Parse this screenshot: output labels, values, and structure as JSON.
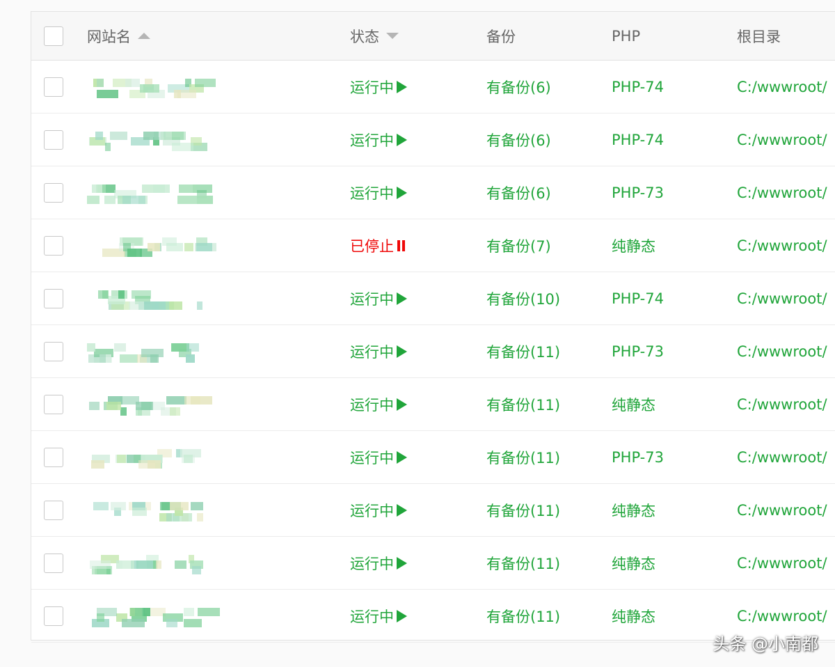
{
  "table": {
    "headers": {
      "name": "网站名",
      "status": "状态",
      "backup": "备份",
      "php": "PHP",
      "root": "根目录"
    },
    "rows": [
      {
        "status": "运行中",
        "state": "running",
        "backup": "有备份(6)",
        "php": "PHP-74",
        "root": "C:/wwwroot/"
      },
      {
        "status": "运行中",
        "state": "running",
        "backup": "有备份(6)",
        "php": "PHP-74",
        "root": "C:/wwwroot/"
      },
      {
        "status": "运行中",
        "state": "running",
        "backup": "有备份(6)",
        "php": "PHP-73",
        "root": "C:/wwwroot/"
      },
      {
        "status": "已停止",
        "state": "stopped",
        "backup": "有备份(7)",
        "php": "纯静态",
        "root": "C:/wwwroot/"
      },
      {
        "status": "运行中",
        "state": "running",
        "backup": "有备份(10)",
        "php": "PHP-74",
        "root": "C:/wwwroot/"
      },
      {
        "status": "运行中",
        "state": "running",
        "backup": "有备份(11)",
        "php": "PHP-73",
        "root": "C:/wwwroot/"
      },
      {
        "status": "运行中",
        "state": "running",
        "backup": "有备份(11)",
        "php": "纯静态",
        "root": "C:/wwwroot/"
      },
      {
        "status": "运行中",
        "state": "running",
        "backup": "有备份(11)",
        "php": "PHP-73",
        "root": "C:/wwwroot/"
      },
      {
        "status": "运行中",
        "state": "running",
        "backup": "有备份(11)",
        "php": "纯静态",
        "root": "C:/wwwroot/"
      },
      {
        "status": "运行中",
        "state": "running",
        "backup": "有备份(11)",
        "php": "纯静态",
        "root": "C:/wwwroot/"
      },
      {
        "status": "运行中",
        "state": "running",
        "backup": "有备份(11)",
        "php": "纯静态",
        "root": "C:/wwwroot/"
      }
    ]
  },
  "watermark": "头条 @小南都",
  "colors": {
    "running": "#20a53a",
    "stopped": "#ef0808",
    "link": "#20a53a"
  }
}
